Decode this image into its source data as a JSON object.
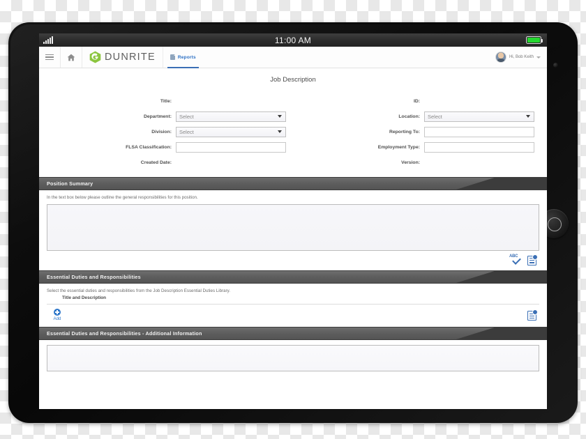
{
  "status_bar": {
    "time": "11:00 AM",
    "signal_icon": "signal-bars-icon",
    "battery_icon": "battery-full-icon"
  },
  "nav": {
    "menu_icon": "hamburger-menu-icon",
    "home_icon": "home-icon",
    "logo_icon": "dunrite-hex-logo-icon",
    "brand": "DUNRITE",
    "tab": {
      "label": "Reports",
      "icon": "report-document-icon"
    },
    "user": {
      "greeting": "Hi, Bob Keith",
      "avatar_icon": "user-avatar",
      "chevron_icon": "chevron-down-icon"
    }
  },
  "page": {
    "title": "Job Description"
  },
  "form": {
    "left": [
      {
        "label": "Title:",
        "type": "static",
        "value": ""
      },
      {
        "label": "Department:",
        "type": "select",
        "value": "Select"
      },
      {
        "label": "Division:",
        "type": "select",
        "value": "Select"
      },
      {
        "label": "FLSA Classification:",
        "type": "input",
        "value": ""
      },
      {
        "label": "Created Date:",
        "type": "static",
        "value": ""
      }
    ],
    "right": [
      {
        "label": "ID:",
        "type": "static",
        "value": ""
      },
      {
        "label": "Location:",
        "type": "select",
        "value": "Select"
      },
      {
        "label": "Reporting To:",
        "type": "input",
        "value": ""
      },
      {
        "label": "Employment Type:",
        "type": "input",
        "value": ""
      },
      {
        "label": "Version:",
        "type": "static",
        "value": ""
      }
    ]
  },
  "sections": {
    "position_summary": {
      "header": "Position Summary",
      "hint": "In the text box below please outline the general responsibilities for this position.",
      "textarea_value": "",
      "tools": {
        "spellcheck_icon": "spellcheck-abc-icon",
        "notes_icon": "notes-add-icon"
      }
    },
    "essential_duties": {
      "header": "Essential Duties and Responsibilities",
      "hint": "Select the essential duties and responsibilities from the Job Description Essential Duties Library.",
      "column_header": "Title and Description",
      "add_label": "Add",
      "add_icon": "plus-circle-icon",
      "notes_icon": "notes-add-icon"
    },
    "essential_duties_additional": {
      "header": "Essential Duties and Responsibilities - Additional Information",
      "textarea_value": ""
    }
  },
  "device": {
    "home_button_icon": "home-button",
    "camera_icon": "front-camera"
  },
  "colors": {
    "brand_green": "#8cc63f",
    "accent_blue": "#2e77c9",
    "section_gray": "#5e5e5e",
    "battery_green": "#25d730"
  }
}
